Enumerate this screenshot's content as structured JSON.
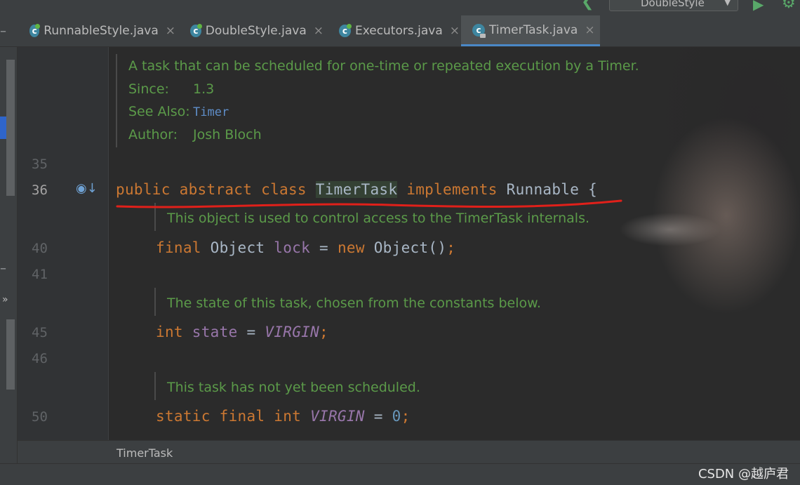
{
  "toolbar": {
    "run_config": "DoubleStyle",
    "icons": [
      "hammer-icon",
      "run-icon",
      "debug-icon",
      "chevron-down-icon"
    ]
  },
  "tabs": [
    {
      "label": "RunnableStyle.java",
      "icon": "java-class-icon",
      "active": false
    },
    {
      "label": "DoubleStyle.java",
      "icon": "java-class-icon",
      "active": false
    },
    {
      "label": "Executors.java",
      "icon": "java-class-icon",
      "active": false
    },
    {
      "label": "TimerTask.java",
      "icon": "java-class-locked-icon",
      "active": true
    }
  ],
  "editor": {
    "class_doc": {
      "description": "A task that can be scheduled for one-time or repeated execution by a Timer.",
      "since_label": "Since:",
      "since_value": "1.3",
      "see_also_label": "See Also:",
      "see_also_value": "Timer",
      "author_label": "Author:",
      "author_value": "Josh Bloch"
    },
    "line_numbers": {
      "l35": "35",
      "l36": "36",
      "l40": "40",
      "l41": "41",
      "l45": "45",
      "l46": "46",
      "l50": "50"
    },
    "class_decl": {
      "public": "public",
      "abstract": "abstract",
      "class": "class",
      "name": "TimerTask",
      "implements": "implements",
      "iface": "Runnable",
      "brace": "{"
    },
    "lock_doc": "This object is used to control access to the TimerTask internals.",
    "lock_decl": {
      "final": "final",
      "type": "Object",
      "name": "lock",
      "eq": "=",
      "new": "new",
      "ctor": "Object()",
      "semi": ";"
    },
    "state_doc": "The state of this task, chosen from the constants below.",
    "state_decl": {
      "type": "int",
      "name": "state",
      "eq": "=",
      "value": "VIRGIN",
      "semi": ";"
    },
    "virgin_doc": "This task has not yet been scheduled.",
    "virgin_decl": {
      "static": "static",
      "final": "final",
      "type": "int",
      "name": "VIRGIN",
      "eq": "=",
      "value": "0",
      "semi": ";"
    }
  },
  "breadcrumb": "TimerTask",
  "watermark": "CSDN @越庐君",
  "colors": {
    "keyword": "#cc7832",
    "field": "#9876aa",
    "number": "#6897bb",
    "doc": "#5b9a49",
    "annotation_line": "#e0201a"
  }
}
